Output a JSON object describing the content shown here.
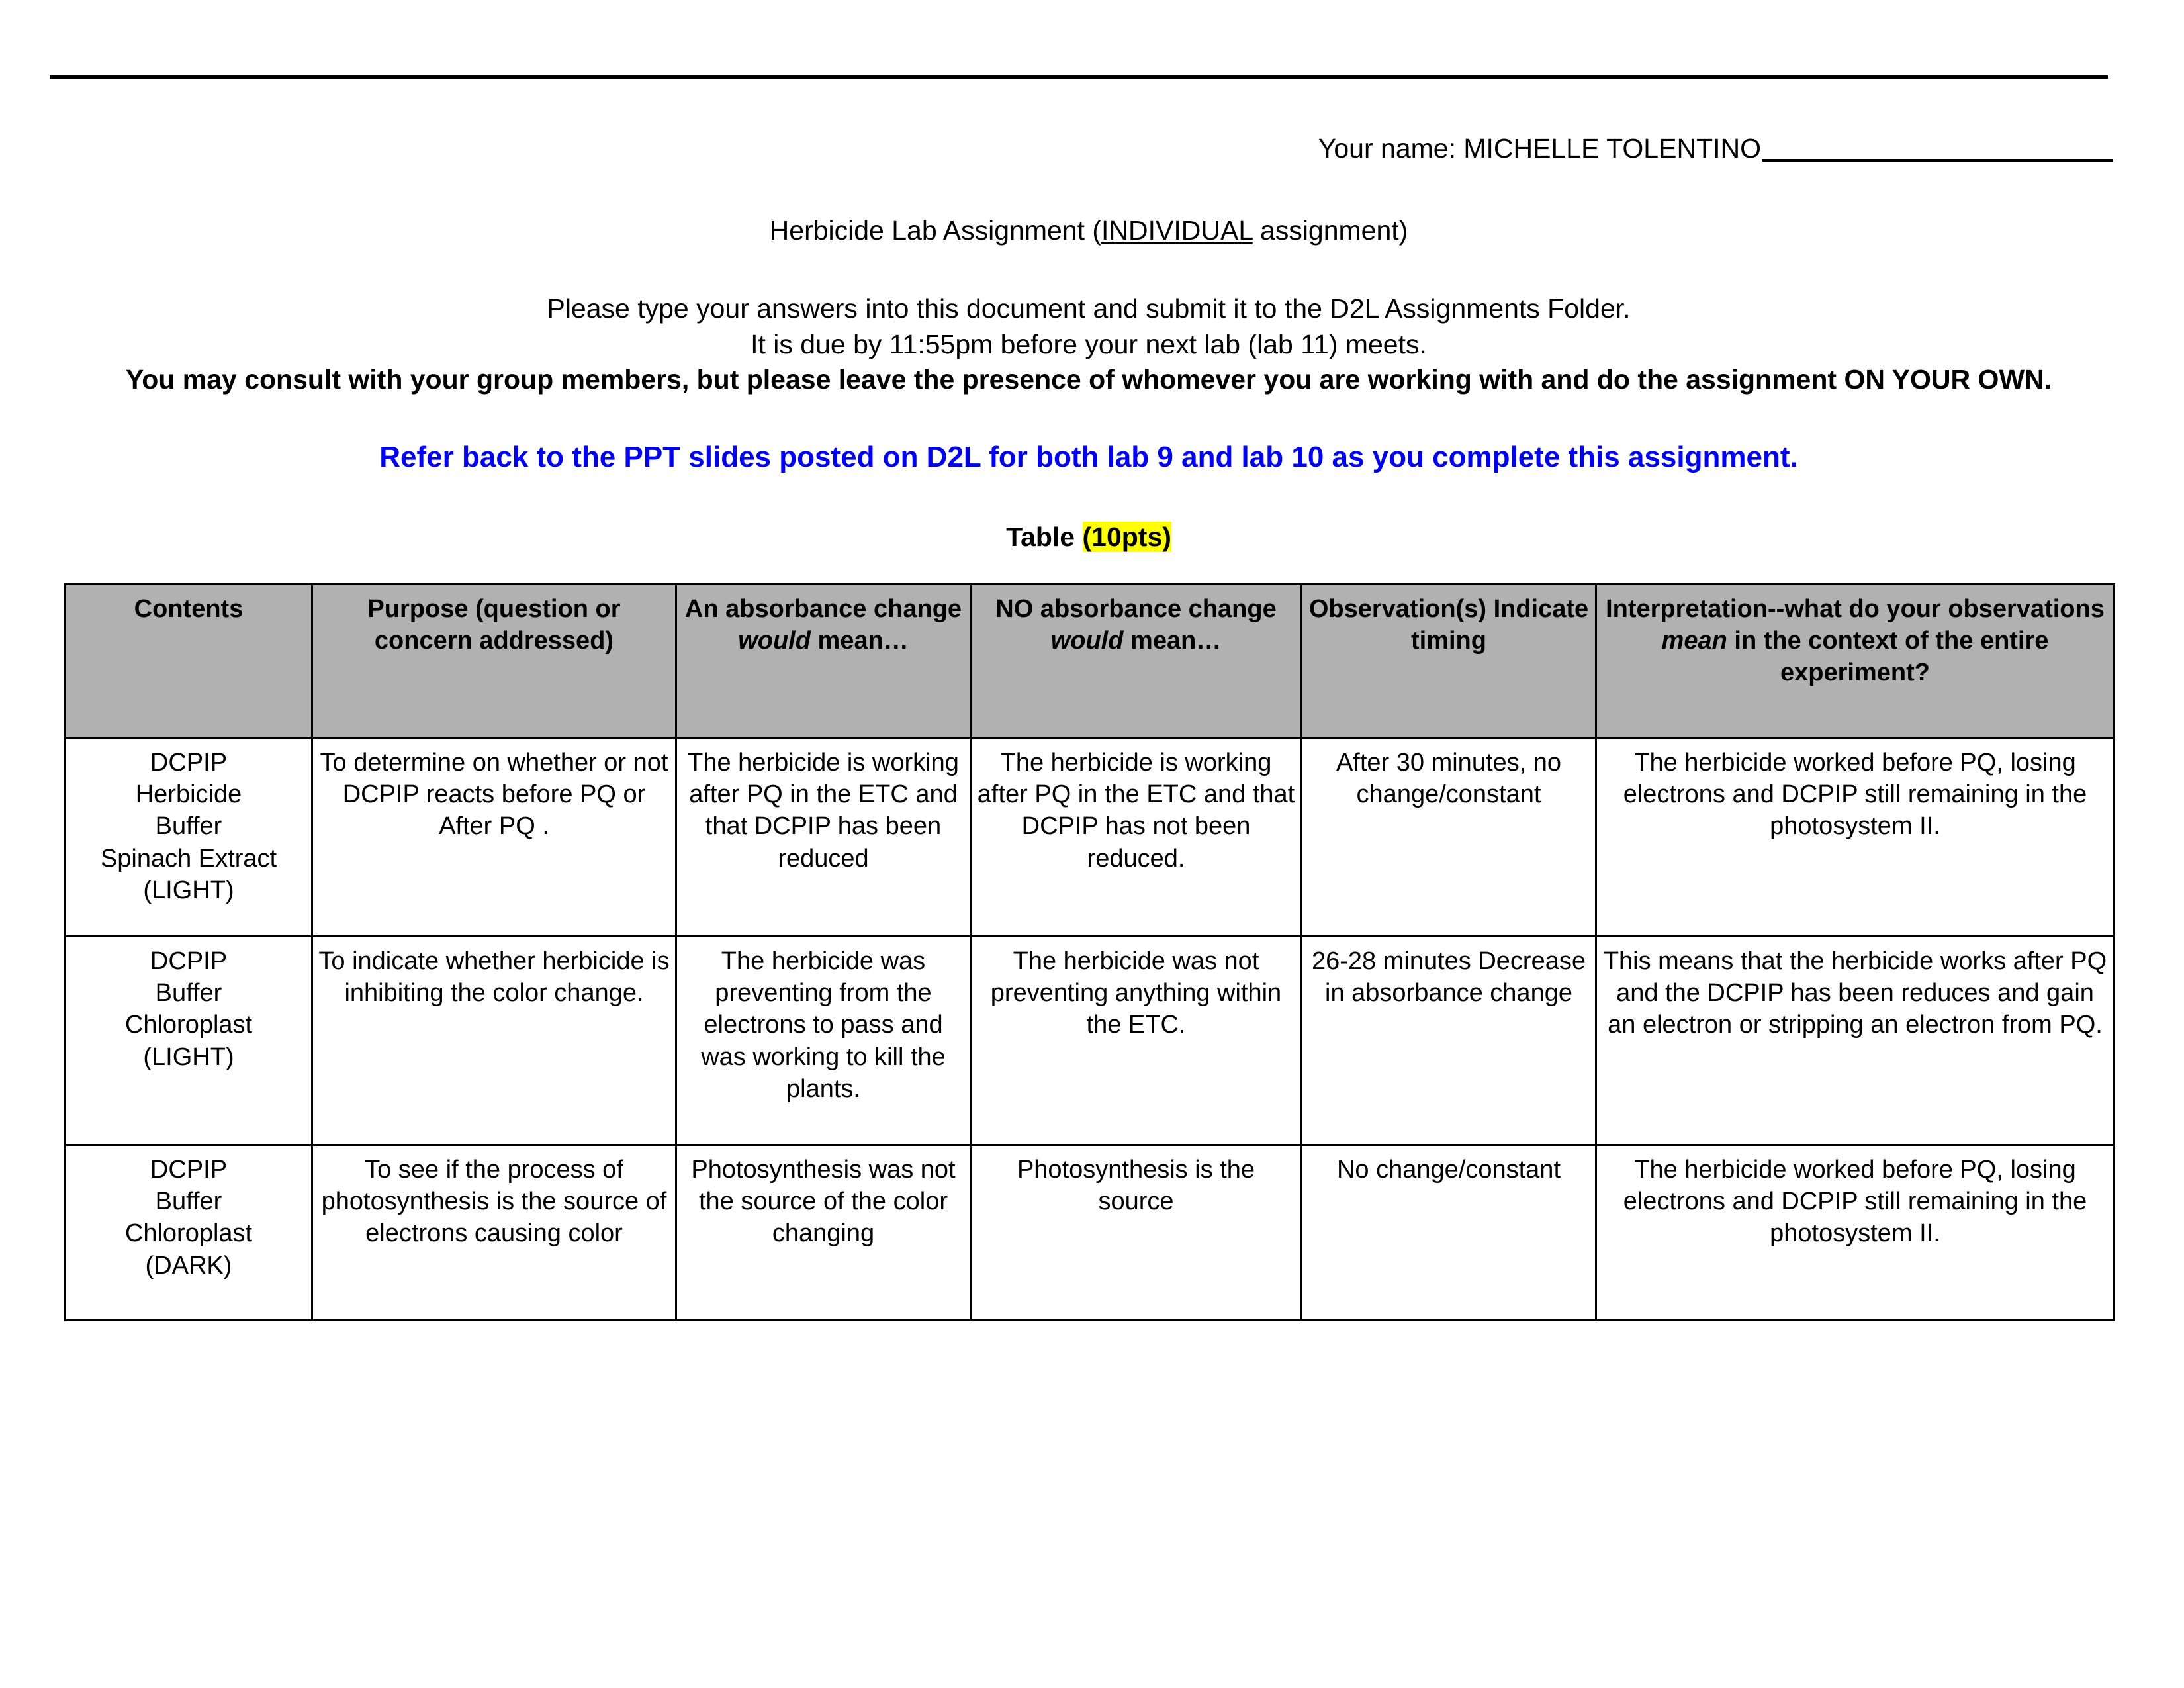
{
  "document": {
    "name_label": "Your name:",
    "student_name": "MICHELLE TOLENTINO",
    "title_prefix": "Herbicide Lab Assignment (",
    "title_underlined": "INDIVIDUAL",
    "title_suffix": " assignment)",
    "instruction_line_1": "Please type your answers into this document and submit it to the D2L Assignments Folder.",
    "instruction_line_2": "It is due by 11:55pm before your next lab (lab 11) meets.",
    "instruction_bold": "You may consult with your group members, but please leave the presence of whomever you are working with and do the assignment ON YOUR OWN.",
    "refer_note": "Refer back to the PPT slides posted on D2L for both lab 9 and lab 10 as you complete this assignment.",
    "table_caption_label": "Table ",
    "table_caption_points": "(10pts)",
    "highlight_color": "#ffff00",
    "accent_color": "#0000ff",
    "header_fill": "#b1b1b1"
  },
  "table": {
    "headers": [
      {
        "line1": "Contents",
        "line2": "",
        "line3": ""
      },
      {
        "line1": "Purpose (question or",
        "line2": "concern addressed)",
        "line3": ""
      },
      {
        "line1": "An absorbance",
        "line2_pre": "change ",
        "line2_em": "would",
        "line3": "mean…"
      },
      {
        "line1": "NO absorbance change",
        "line2_em": "would",
        "line2_post": " mean…"
      },
      {
        "line1": "Observation(s)",
        "line2": "Indicate timing",
        "line3": ""
      },
      {
        "line1": "Interpretation--what do your",
        "line2_pre": "observations ",
        "line2_em": "mean",
        "line2_post": " in the context",
        "line3": "of the entire experiment?"
      }
    ],
    "rows": [
      {
        "contents": "DCPIP\nHerbicide\nBuffer\nSpinach Extract\n(LIGHT)",
        "purpose": "To determine on whether or not DCPIP reacts before PQ or After PQ .",
        "absorbance_change": "The herbicide is working after PQ in the ETC and that DCPIP has been reduced",
        "no_absorbance_change": "The herbicide is working after PQ in the ETC and that DCPIP has not been reduced.",
        "observations": "After 30 minutes, no change/constant",
        "interpretation": "The herbicide worked before PQ, losing electrons and DCPIP still remaining in the photosystem II."
      },
      {
        "contents": "DCPIP\nBuffer\nChloroplast\n(LIGHT)",
        "purpose": "To indicate whether herbicide is inhibiting the color change.",
        "absorbance_change": "The herbicide was preventing from the electrons to pass and was working to kill the plants.",
        "no_absorbance_change": "The herbicide was not preventing anything within the ETC.",
        "observations": "26-28 minutes Decrease in absorbance change",
        "interpretation": "This means that the herbicide works after PQ and the DCPIP has been reduces and gain an electron or stripping an electron from PQ."
      },
      {
        "contents": "DCPIP\nBuffer\nChloroplast\n(DARK)",
        "purpose": "To see if the process of photosynthesis is the source of electrons causing color",
        "absorbance_change": "Photosynthesis was not the source of the color changing",
        "no_absorbance_change": "Photosynthesis is the source",
        "observations": "No change/constant",
        "interpretation": "The herbicide worked before PQ, losing electrons and DCPIP still remaining in the photosystem II."
      }
    ]
  }
}
